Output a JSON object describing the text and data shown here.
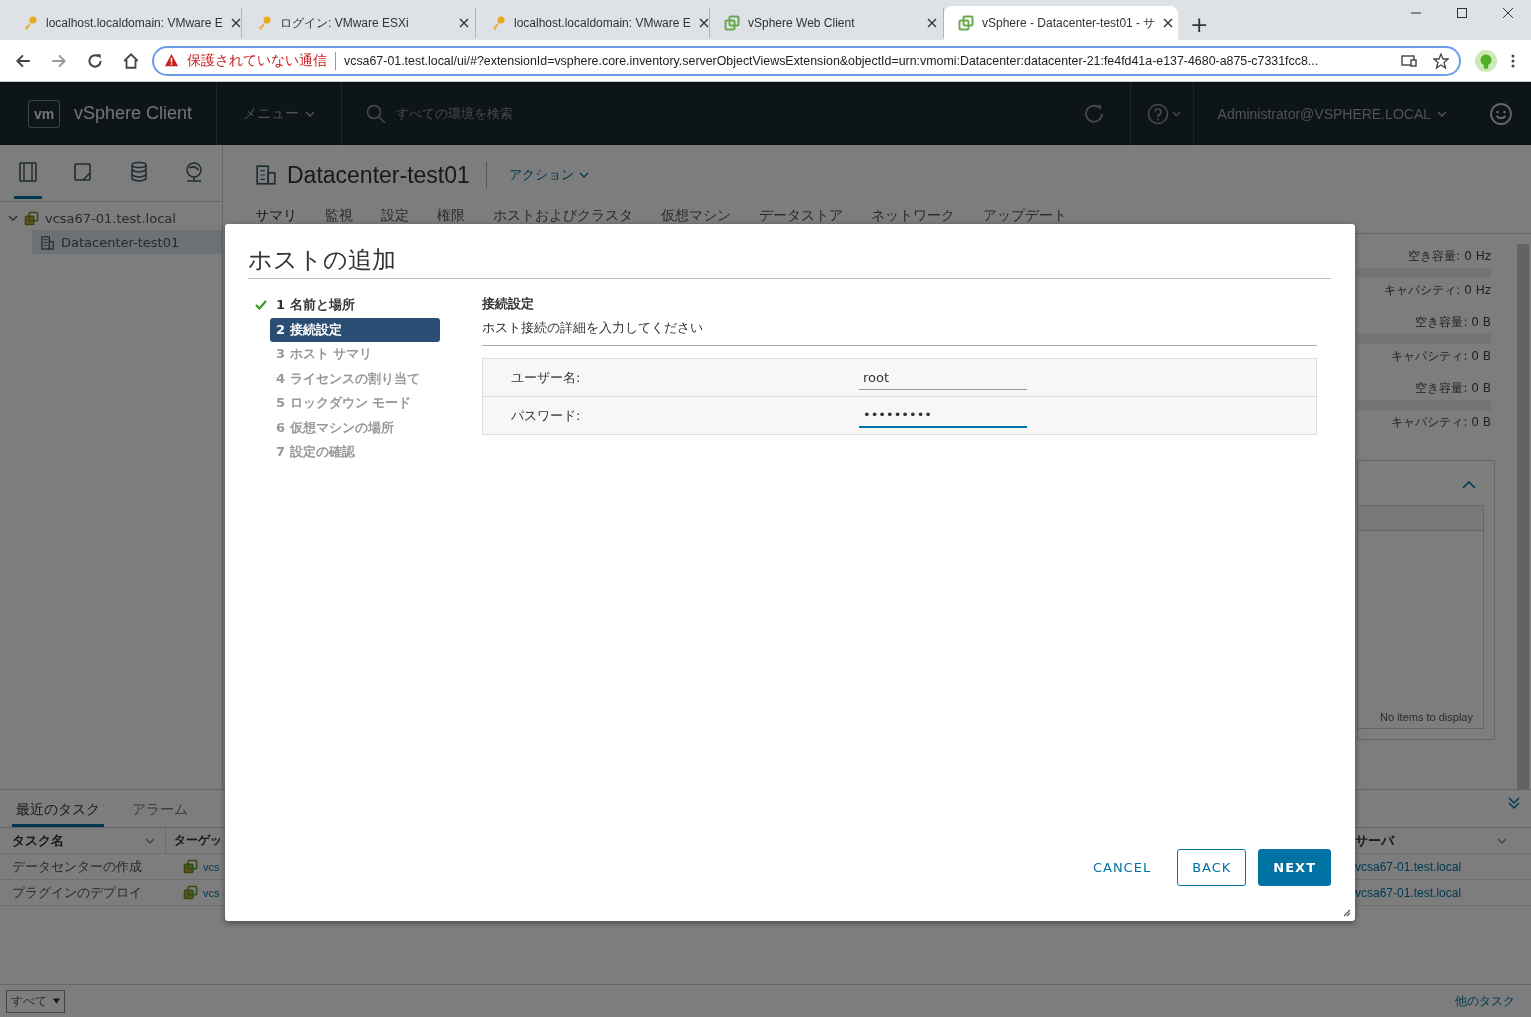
{
  "browser": {
    "tabs": [
      {
        "title": "localhost.localdomain: VMware E",
        "kind": "esxi",
        "selected": false
      },
      {
        "title": "ログイン: VMware ESXi",
        "kind": "esxi",
        "selected": false
      },
      {
        "title": "localhost.localdomain: VMware E",
        "kind": "esxi",
        "selected": false
      },
      {
        "title": "vSphere Web Client",
        "kind": "vsphere",
        "selected": false
      },
      {
        "title": "vSphere - Datacenter-test01 - サ",
        "kind": "vsphere",
        "selected": true
      }
    ],
    "new_tab": "+",
    "security_warning": "保護されていない通信",
    "url": "vcsa67-01.test.local/ui/#?extensionId=vsphere.core.inventory.serverObjectViewsExtension&objectId=urn:vmomi:Datacenter:datacenter-21:fe4fd41a-e137-4680-a875-c7331fcc8..."
  },
  "header": {
    "logo": "vm",
    "app_name": "vSphere Client",
    "menu": "メニュー",
    "search": {
      "placeholder": "すべての環境を検索"
    },
    "user": "Administrator@VSPHERE.LOCAL"
  },
  "sidebar": {
    "views": [
      {
        "kind": "hosts",
        "selected": true
      },
      {
        "kind": "vms",
        "selected": false
      },
      {
        "kind": "storage",
        "selected": false
      },
      {
        "kind": "network",
        "selected": false
      }
    ],
    "tree": [
      {
        "label": "vcsa67-01.test.local",
        "expanded": true,
        "selected": false,
        "children": [
          {
            "label": "Datacenter-test01",
            "selected": true
          }
        ]
      }
    ]
  },
  "content": {
    "title": "Datacenter-test01",
    "actions": "アクション",
    "tabs": [
      {
        "label": "サマリ",
        "selected": true
      },
      {
        "label": "監視",
        "selected": false
      },
      {
        "label": "設定",
        "selected": false
      },
      {
        "label": "権限",
        "selected": false
      },
      {
        "label": "ホストおよびクラスタ",
        "selected": false
      },
      {
        "label": "仮想マシン",
        "selected": false
      },
      {
        "label": "データストア",
        "selected": false
      },
      {
        "label": "ネットワーク",
        "selected": false
      },
      {
        "label": "アップデート",
        "selected": false
      }
    ],
    "resources": [
      {
        "free": "空き容量: 0 Hz",
        "capacity": "キャパシティ: 0 Hz"
      },
      {
        "free": "空き容量: 0 B",
        "capacity": "キャパシティ: 0 B"
      },
      {
        "free": "空き容量: 0 B",
        "capacity": "キャパシティ: 0 B"
      }
    ],
    "empty_message": "No items to display"
  },
  "tasks": {
    "tabs": [
      {
        "label": "最近のタスク",
        "selected": true
      },
      {
        "label": "アラーム",
        "selected": false
      }
    ],
    "columns": [
      "タスク名",
      "ターゲッ",
      "サーバ"
    ],
    "rows": [
      {
        "task": "データセンターの作成",
        "target": "vcs",
        "server": "vcsa67-01.test.local"
      },
      {
        "task": "プラグインのデプロイ",
        "target": "vcs",
        "server": "vcsa67-01.test.local"
      }
    ],
    "filter": "すべて",
    "more": "他のタスク"
  },
  "dialog": {
    "title": "ホストの追加",
    "steps": [
      {
        "label": "1 名前と場所",
        "completed": true,
        "selected": false
      },
      {
        "label": "2 接続設定",
        "completed": false,
        "selected": true
      },
      {
        "label": "3 ホスト サマリ",
        "completed": false,
        "selected": false
      },
      {
        "label": "4 ライセンスの割り当て",
        "completed": false,
        "selected": false
      },
      {
        "label": "5 ロックダウン モード",
        "completed": false,
        "selected": false
      },
      {
        "label": "6 仮想マシンの場所",
        "completed": false,
        "selected": false
      },
      {
        "label": "7 設定の確認",
        "completed": false,
        "selected": false
      }
    ],
    "section_title": "接続設定",
    "section_subtitle": "ホスト接続の詳細を入力してください",
    "fields": [
      {
        "label": "ユーザー名:",
        "value": "root",
        "focused": false
      },
      {
        "label": "パスワード:",
        "value": "•••••••••",
        "focused": true
      }
    ],
    "buttons": [
      {
        "label": "CANCEL",
        "kind": "flat"
      },
      {
        "label": "BACK",
        "kind": "outline"
      },
      {
        "label": "NEXT",
        "kind": "primary"
      }
    ]
  }
}
